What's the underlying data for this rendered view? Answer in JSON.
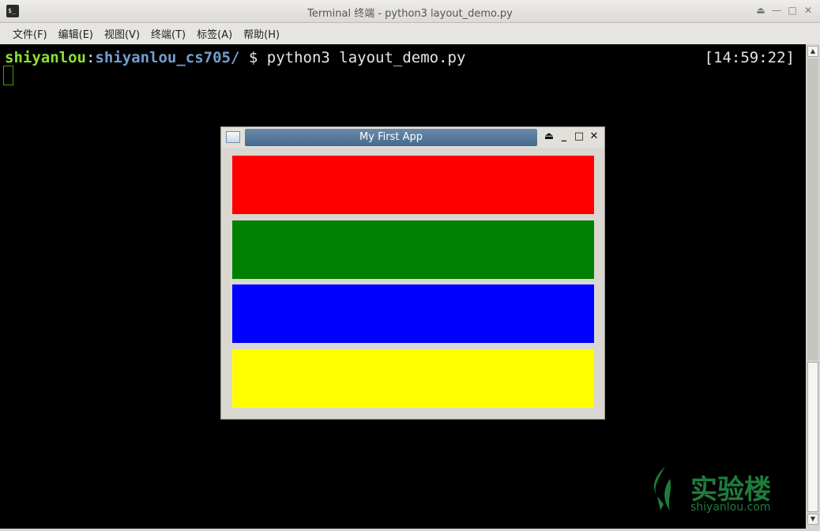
{
  "window": {
    "title": "Terminal 终端 - python3 layout_demo.py",
    "controls": [
      "⏏",
      "—",
      "□",
      "✕"
    ]
  },
  "menu": [
    {
      "label": "文件(F)"
    },
    {
      "label": "编辑(E)"
    },
    {
      "label": "视图(V)"
    },
    {
      "label": "终端(T)"
    },
    {
      "label": "标签(A)"
    },
    {
      "label": "帮助(H)"
    }
  ],
  "terminal": {
    "user": "shiyanlou",
    "sep": ":",
    "path": "shiyanlou_cs705/",
    "command": " $ python3 layout_demo.py",
    "clock": "[14:59:22]",
    "colors": {
      "user": "#8ae234",
      "path": "#729fcf",
      "background": "#000000"
    }
  },
  "app_window": {
    "title": "My First App",
    "controls": [
      "⏏",
      "_",
      "□",
      "✕"
    ],
    "blocks": [
      {
        "name": "red",
        "color": "#ff0000"
      },
      {
        "name": "green",
        "color": "#008000"
      },
      {
        "name": "blue",
        "color": "#0000ff"
      },
      {
        "name": "yellow",
        "color": "#ffff00"
      }
    ]
  },
  "watermark": {
    "cn": "实验楼",
    "en": "shiyanlou.com"
  }
}
